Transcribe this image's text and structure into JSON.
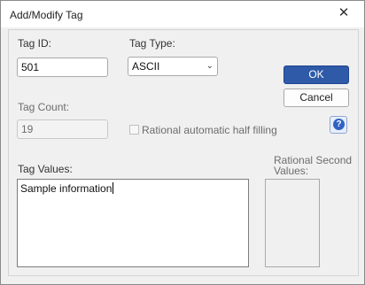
{
  "window": {
    "title": "Add/Modify Tag"
  },
  "form": {
    "tag_id_label": "Tag ID:",
    "tag_id_value": "501",
    "tag_type_label": "Tag Type:",
    "tag_type_value": "ASCII",
    "tag_count_label": "Tag Count:",
    "tag_count_value": "19",
    "rational_checkbox_label": "Rational automatic half filling",
    "rational_checkbox_checked": false,
    "tag_values_label": "Tag Values:",
    "tag_values_value": "Sample information",
    "rational_second_label_line1": "Rational Second",
    "rational_second_label_line2": "Values:"
  },
  "buttons": {
    "ok": "OK",
    "cancel": "Cancel"
  },
  "icons": {
    "close": "close-icon",
    "help": "help-icon",
    "dropdown": "chevron-down-icon"
  },
  "colors": {
    "ok_button": "#2e5aa8",
    "help_icon": "#2f63c2"
  }
}
